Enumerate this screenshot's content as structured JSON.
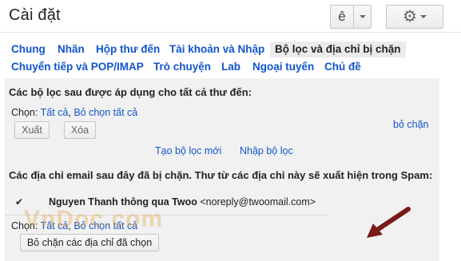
{
  "header": {
    "title": "Cài đặt",
    "language_button": "ê"
  },
  "tabs": [
    {
      "label": "Chung"
    },
    {
      "label": "Nhãn"
    },
    {
      "label": "Hộp thư đến"
    },
    {
      "label": "Tài khoản và Nhập"
    },
    {
      "label": "Bộ lọc và địa chỉ bị chặn",
      "active": true
    },
    {
      "label": "Chuyển tiếp và POP/IMAP"
    },
    {
      "label": "Trò chuyện"
    },
    {
      "label": "Lab"
    },
    {
      "label": "Ngoại tuyến"
    },
    {
      "label": "Chủ đề"
    }
  ],
  "filters": {
    "heading": "Các bộ lọc sau được áp dụng cho tất cả thư đến:",
    "select_label": "Chọn:",
    "select_all": "Tất cả",
    "select_separator": ",",
    "select_none": "Bỏ chọn tất cả",
    "export_button": "Xuất",
    "delete_button": "Xóa",
    "create_link": "Tạo bộ lọc mới",
    "import_link": "Nhập bộ lọc"
  },
  "blocked": {
    "heading": "Các địa chỉ email sau đây đã bị chặn. Thư từ các địa chỉ này sẽ xuất hiện trong Spam:",
    "row": {
      "checkbox": "✔",
      "sender_name": "Nguyen Thanh thông qua Twoo",
      "sender_email": "<noreply@twoomail.com>",
      "unblock_link": "bỏ chặn"
    },
    "select_label": "Chọn:",
    "select_all": "Tất cả",
    "select_separator": ",",
    "select_none": "Bỏ chọn tất cả",
    "unblock_selected_button": "Bỏ chặn các địa chỉ đã chọn"
  },
  "watermark": "VnDoc.com",
  "colors": {
    "link": "#1155cc",
    "panel_bg": "#f1f1f1",
    "active_tab_bg": "#ebebeb",
    "arrow": "#7a1a1a"
  },
  "icons": {
    "settings": "gear-icon",
    "dropdown": "chevron-down-icon",
    "annotation": "arrow-icon"
  }
}
